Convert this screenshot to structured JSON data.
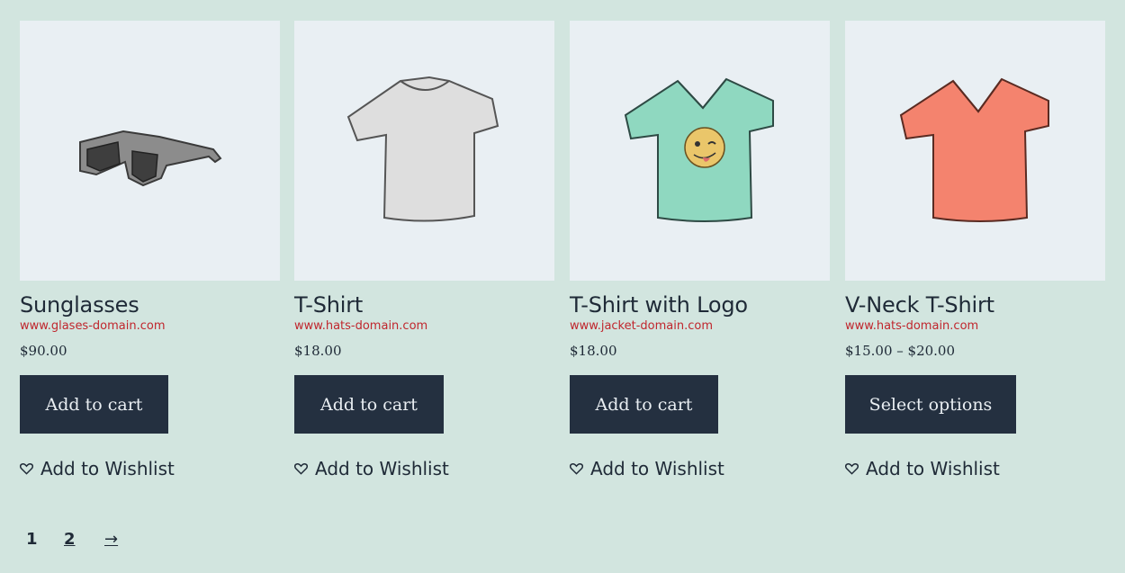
{
  "products": [
    {
      "title": "Sunglasses",
      "domain": "www.glases-domain.com",
      "price": "$90.00",
      "button": "Add to cart",
      "wishlist": "Add to Wishlist",
      "image": "sunglasses-image"
    },
    {
      "title": "T-Shirt",
      "domain": "www.hats-domain.com",
      "price": "$18.00",
      "button": "Add to cart",
      "wishlist": "Add to Wishlist",
      "image": "grey-tshirt-image"
    },
    {
      "title": "T-Shirt with Logo",
      "domain": "www.jacket-domain.com",
      "price": "$18.00",
      "button": "Add to cart",
      "wishlist": "Add to Wishlist",
      "image": "mint-logo-tshirt-image"
    },
    {
      "title": "V-Neck T-Shirt",
      "domain": "www.hats-domain.com",
      "price": "$15.00 – $20.00",
      "button": "Select options",
      "wishlist": "Add to Wishlist",
      "image": "coral-vneck-tshirt-image"
    }
  ],
  "pagination": {
    "current": "1",
    "page2": "2",
    "next": "→"
  },
  "colors": {
    "background": "#d2e5df",
    "button": "#243040",
    "domain_link": "#c0262d",
    "image_bg": "#e9eff3"
  }
}
